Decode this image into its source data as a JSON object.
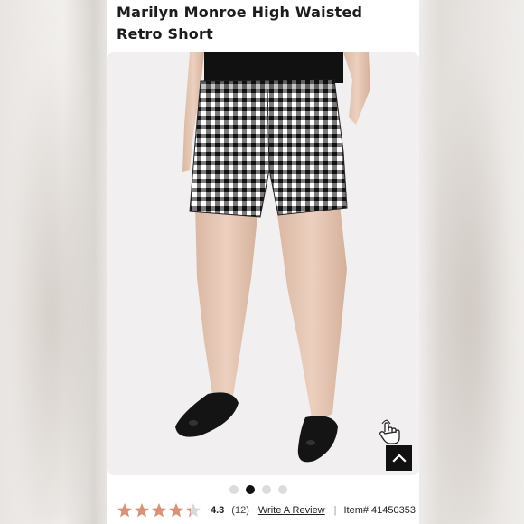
{
  "product": {
    "title": "Marilyn Monroe High Waisted Retro Short"
  },
  "gallery": {
    "slide_count": 4,
    "active_slide": 2
  },
  "rating": {
    "value": "4.3",
    "stars_filled": 4.3,
    "stars_total": 5,
    "count": "(12)",
    "write_review_label": "Write A Review",
    "separator": "|",
    "item_label": "Item#",
    "item_number": "41450353"
  },
  "icons": {
    "zoom": "pointer-hand-icon",
    "back_to_top": "chevron-up-icon"
  },
  "colors": {
    "star": "#d8927a",
    "star_empty": "#d9d9d9",
    "accent_dark": "#111111"
  }
}
